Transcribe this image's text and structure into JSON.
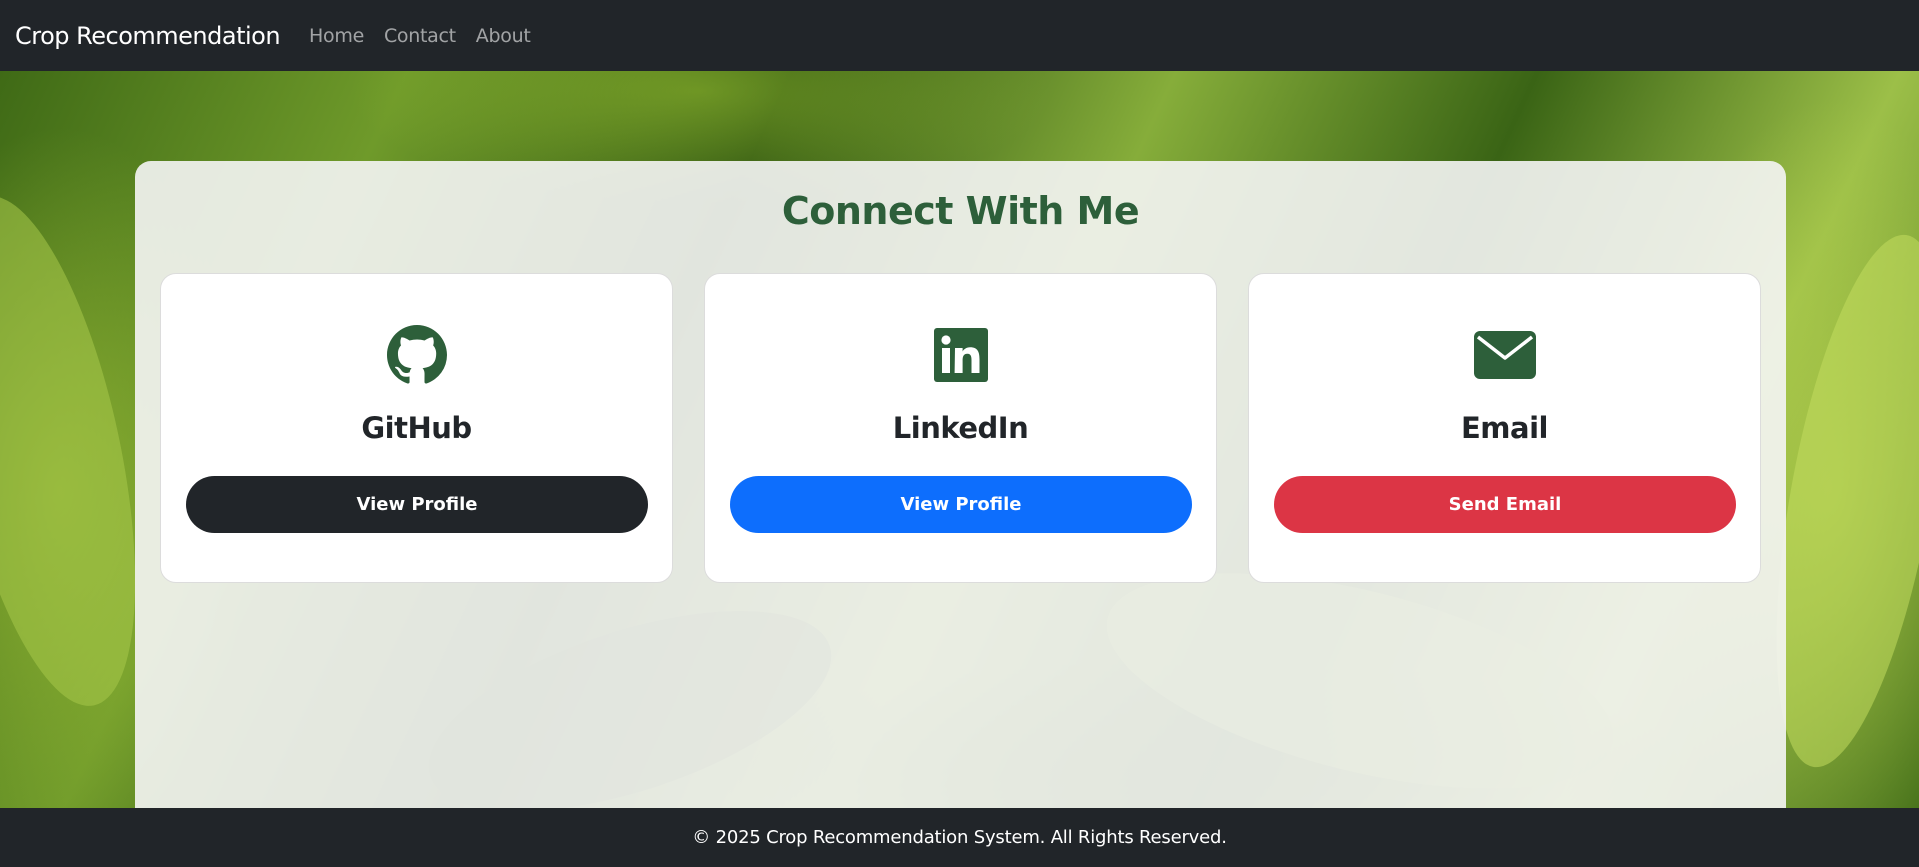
{
  "navbar": {
    "brand": "Crop Recommendation",
    "links": [
      {
        "label": "Home"
      },
      {
        "label": "Contact"
      },
      {
        "label": "About"
      }
    ]
  },
  "contact": {
    "title": "Connect With Me",
    "accent_color": "#2d5f3a",
    "cards": [
      {
        "icon": "github-icon",
        "title": "GitHub",
        "button_label": "View Profile",
        "button_color": "#212529"
      },
      {
        "icon": "linkedin-icon",
        "title": "LinkedIn",
        "button_label": "View Profile",
        "button_color": "#0d6efd"
      },
      {
        "icon": "envelope-icon",
        "title": "Email",
        "button_label": "Send Email",
        "button_color": "#dc3545"
      }
    ]
  },
  "footer": {
    "text": "© 2025 Crop Recommendation System. All Rights Reserved."
  }
}
